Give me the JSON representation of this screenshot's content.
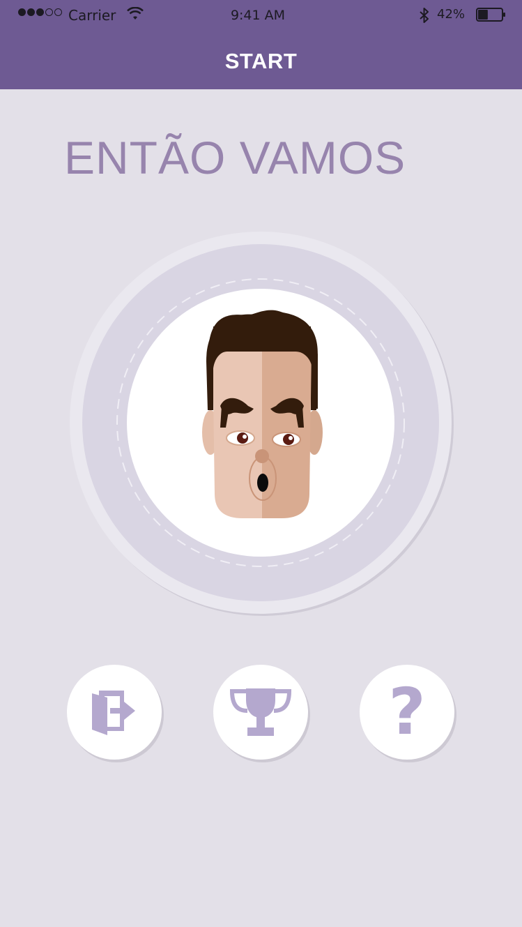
{
  "status_bar": {
    "carrier": "Carrier",
    "time": "9:41 AM",
    "battery_percent": "42%",
    "signal_bars_filled": 3,
    "signal_bars_total": 5,
    "battery_level": 0.42
  },
  "header": {
    "title": "START"
  },
  "main": {
    "headline": "ENTÃO VAMOS",
    "avatar_icon": "cartoon-face-icon"
  },
  "actions": [
    {
      "name": "exit",
      "icon": "door-exit-icon"
    },
    {
      "name": "ranking",
      "icon": "trophy-icon"
    },
    {
      "name": "help",
      "icon": "question-mark-icon",
      "glyph": "?"
    }
  ],
  "colors": {
    "header": "#6e5a93",
    "background": "#e3e0e8",
    "accent": "#9784ad",
    "icon": "#b4a8ce"
  }
}
